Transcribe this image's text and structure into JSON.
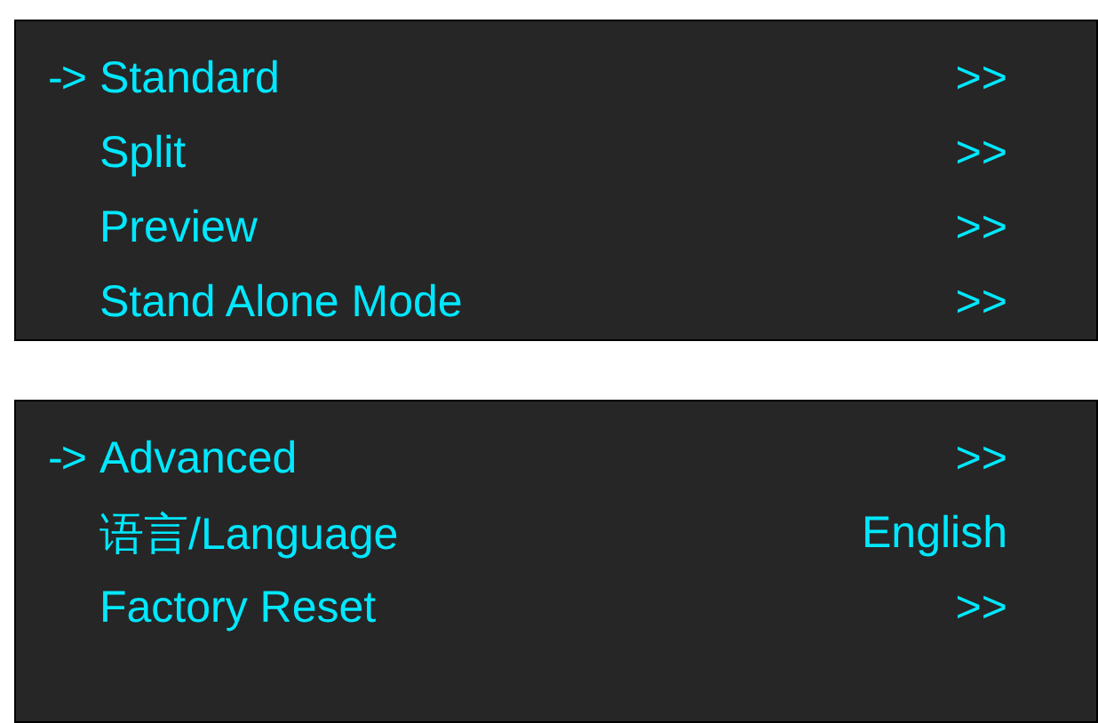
{
  "menus": [
    {
      "items": [
        {
          "cursor": "->",
          "label": "Standard",
          "value": ">>"
        },
        {
          "label": "Split",
          "value": ">>"
        },
        {
          "label": "Preview",
          "value": ">>"
        },
        {
          "label": "Stand Alone Mode",
          "value": ">>"
        }
      ]
    },
    {
      "items": [
        {
          "cursor": "->",
          "label": "Advanced",
          "value": ">>"
        },
        {
          "label": "语言/Language",
          "value": "English"
        },
        {
          "label": "Factory Reset",
          "value": ">>"
        }
      ]
    }
  ]
}
